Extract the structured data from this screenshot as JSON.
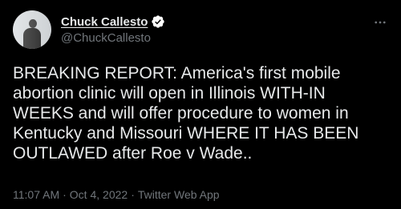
{
  "author": {
    "display_name": "Chuck Callesto",
    "handle": "@ChuckCallesto",
    "verified": true
  },
  "tweet": {
    "text": "BREAKING REPORT: America's first mobile abortion clinic will open in Illinois WITH-IN WEEKS and will offer procedure to women in Kentucky and Missouri WHERE IT HAS BEEN OUTLAWED after Roe v Wade.."
  },
  "meta": {
    "time": "11:07 AM",
    "separator": "·",
    "date": "Oct 4, 2022",
    "source": "Twitter Web App"
  },
  "colors": {
    "background": "#000000",
    "text": "#e7e9ea",
    "secondary": "#71767b",
    "verified_badge": "#ffffff"
  },
  "icons": {
    "verified": "verified-badge-icon",
    "more": "more-options-icon"
  }
}
